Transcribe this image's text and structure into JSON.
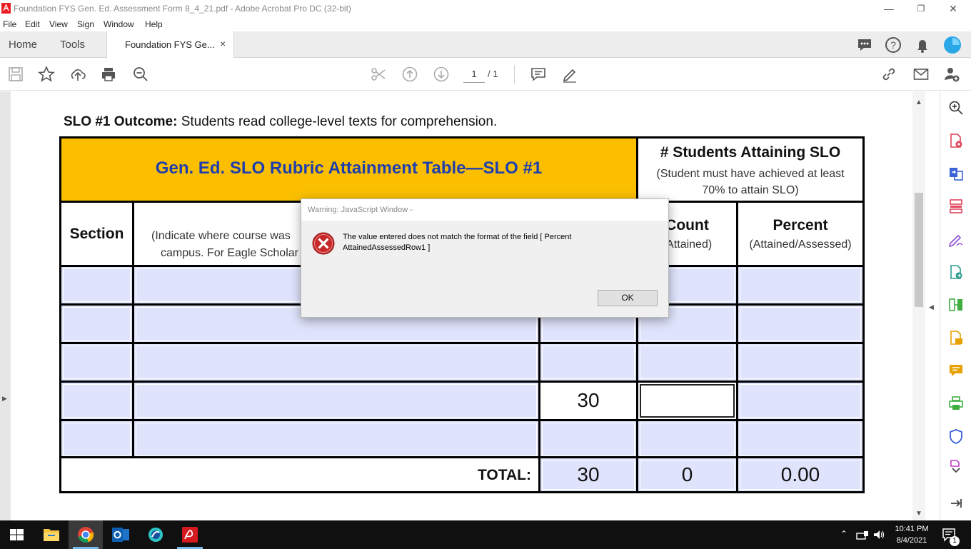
{
  "window": {
    "title": "Foundation FYS Gen. Ed. Assessment Form 8_4_21.pdf - Adobe Acrobat Pro DC (32-bit)",
    "minimize": "—",
    "restore": "❐",
    "close": "✕"
  },
  "menu": [
    "File",
    "Edit",
    "View",
    "Sign",
    "Window",
    "Help"
  ],
  "tabs": {
    "home": "Home",
    "tools": "Tools",
    "document": "Foundation FYS Ge...",
    "close": "×"
  },
  "toolbar": {
    "page_current": "1",
    "page_total": "/ 1"
  },
  "document": {
    "slo_label": "SLO #1 Outcome:",
    "slo_text": " Students read college-level texts for comprehension.",
    "table_title": "Gen. Ed. SLO Rubric Attainment Table—SLO #1",
    "attaining_header": "# Students Attaining SLO",
    "attaining_sub": "(Student must have achieved at least 70% to attain SLO)",
    "section_header": "Section",
    "location_sub_1": "(Indicate where course was",
    "location_sub_2": "campus. For Eagle Scholar",
    "count_header": "Count",
    "count_sub": "(Attained)",
    "percent_header": "Percent",
    "percent_sub": "(Attained/Assessed)",
    "row4_assessed": "30",
    "total_label": "TOTAL:",
    "total_assessed": "30",
    "total_count": "0",
    "total_percent": "0.00"
  },
  "dialog": {
    "title": "Warning: JavaScript Window -",
    "message": "The value entered does not match the format of the field [ Percent AttainedAssessedRow1 ]",
    "ok": "OK"
  },
  "taskbar": {
    "time": "10:41 PM",
    "date": "8/4/2021",
    "notification_count": "1"
  },
  "colors": {
    "header_gold": "#fbbf00",
    "title_blue": "#1f3fae",
    "field_blue": "#dfe3fb",
    "error_red": "#c62828"
  },
  "icons": {
    "window": [
      "acrobat-app-icon"
    ],
    "header": [
      "chat-icon",
      "help-icon",
      "bell-icon",
      "account-icon"
    ],
    "toolbar": [
      "save-icon",
      "star-icon",
      "upload-icon",
      "print-icon",
      "zoom-out-icon",
      "scissors-icon",
      "page-up-icon",
      "page-down-icon",
      "comment-icon",
      "pen-icon",
      "link-icon",
      "email-icon",
      "add-user-icon"
    ],
    "right_panel": [
      "zoom-in-icon",
      "export-pdf-icon",
      "create-pdf-icon",
      "organize-pages-icon",
      "fill-sign-icon",
      "send-review-icon",
      "compress-icon",
      "edit-pdf-icon",
      "comment-panel-icon",
      "print-production-icon",
      "protect-icon",
      "more-tools-icon",
      "collapse-panel-icon"
    ],
    "taskbar": [
      "windows-start-icon",
      "file-explorer-icon",
      "chrome-icon",
      "outlook-icon",
      "app-icon",
      "acrobat-icon",
      "chevron-up-icon",
      "network-icon",
      "volume-icon",
      "notification-icon"
    ]
  }
}
